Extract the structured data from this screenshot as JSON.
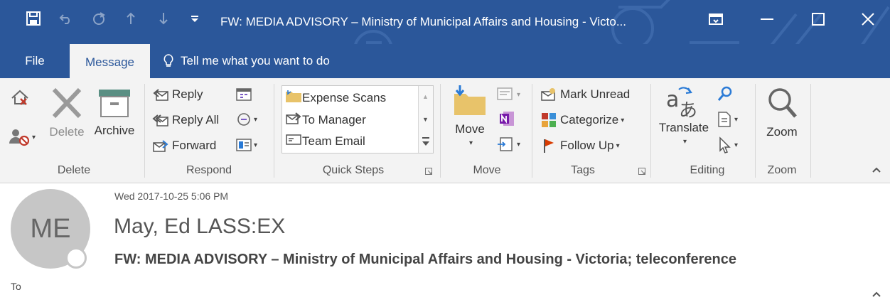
{
  "window": {
    "title": "FW: MEDIA ADVISORY – Ministry of Municipal Affairs and Housing - Victo...",
    "accent": "#2b579a"
  },
  "quick_access": [
    "save-icon",
    "undo-icon",
    "redo-icon",
    "up-arrow-icon",
    "down-arrow-icon",
    "customize-icon"
  ],
  "tabs": {
    "file": "File",
    "message": "Message",
    "tell_me": "Tell me what you want to do"
  },
  "ribbon": {
    "delete_group": {
      "delete": "Delete",
      "archive": "Archive",
      "label": "Delete"
    },
    "respond_group": {
      "reply": "Reply",
      "reply_all": "Reply All",
      "forward": "Forward",
      "label": "Respond"
    },
    "quick_steps": {
      "items": [
        "Expense Scans",
        "To Manager",
        "Team Email"
      ],
      "label": "Quick Steps"
    },
    "move_group": {
      "move": "Move",
      "label": "Move"
    },
    "tags_group": {
      "mark_unread": "Mark Unread",
      "categorize": "Categorize",
      "follow_up": "Follow Up",
      "label": "Tags"
    },
    "editing_group": {
      "translate": "Translate",
      "label": "Editing"
    },
    "zoom_group": {
      "zoom": "Zoom",
      "label": "Zoom"
    }
  },
  "message": {
    "date": "Wed 2017-10-25 5:06 PM",
    "initials": "ME",
    "sender": "May, Ed LASS:EX",
    "subject": "FW: MEDIA ADVISORY – Ministry of Municipal Affairs and Housing - Victoria; teleconference",
    "to_label": "To"
  }
}
